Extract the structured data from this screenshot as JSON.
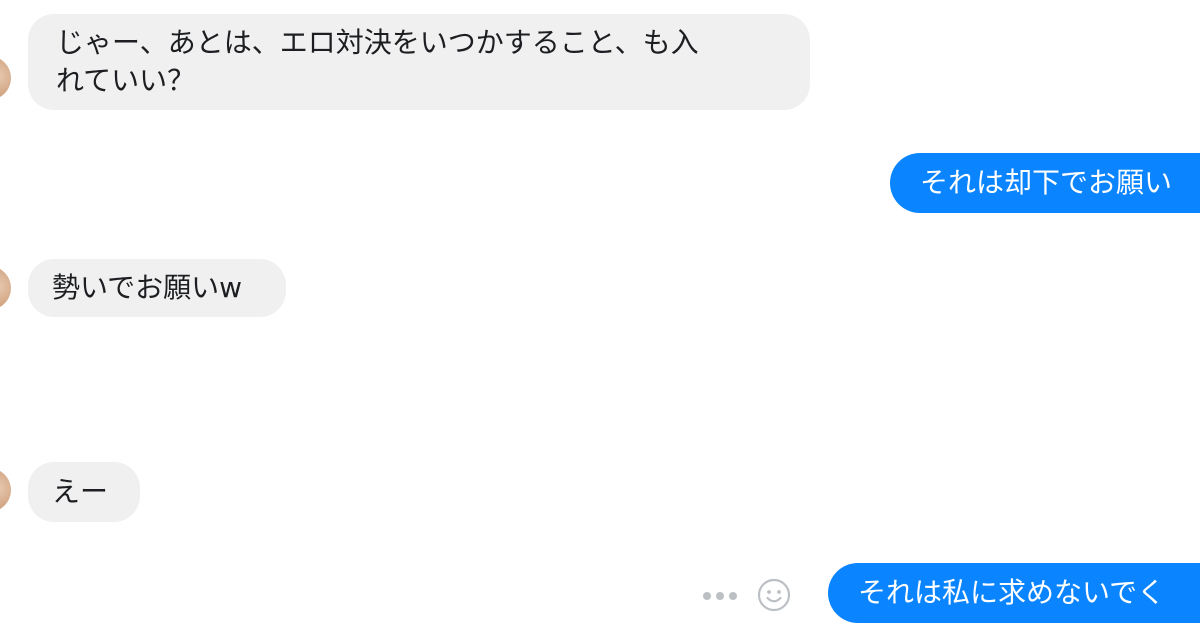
{
  "messages": {
    "m1": {
      "line1": "じゃー、あとは、エロ対決をいつかすること、も入",
      "line2": "れていい？"
    },
    "m2": {
      "text": "それは却下でお願い"
    },
    "m3": {
      "text": "勢いでお願いw"
    },
    "m4": {
      "text": "えー"
    },
    "m5": {
      "text": "それは私に求めないでく"
    }
  },
  "icons": {
    "more": "more-dots-icon",
    "react": "smiley-react-icon"
  },
  "colors": {
    "incoming_bubble": "#f0f0f0",
    "outgoing_bubble": "#0a84ff",
    "text_dark": "#1c1e21",
    "icon_gray": "#bcc0c4"
  }
}
